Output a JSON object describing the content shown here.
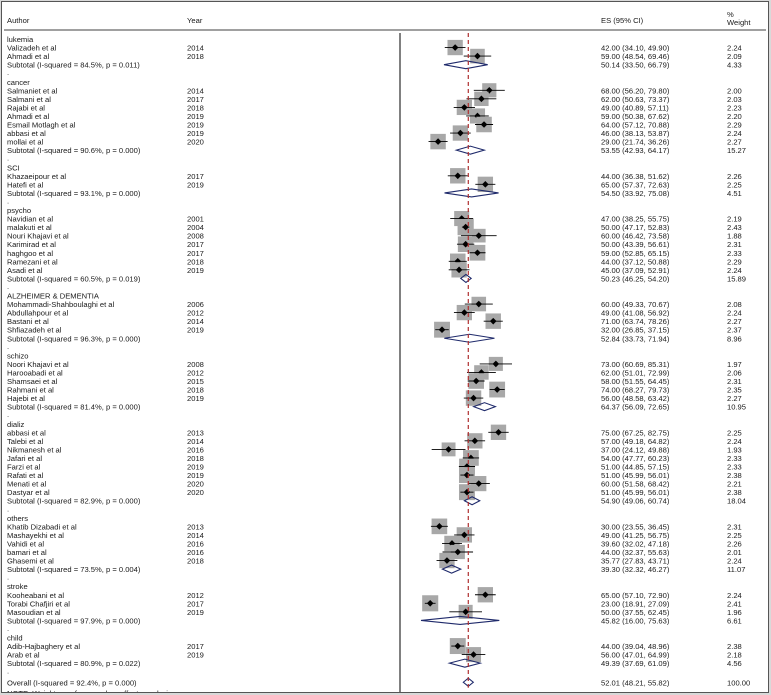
{
  "header": {
    "author": "Author",
    "year": "Year",
    "es": "ES (95% CI)",
    "weight_line1": "%",
    "weight_line2": "Weight"
  },
  "chart_data": {
    "type": "forest",
    "x_axis": {
      "ticks": [
        "-85.3",
        "0",
        "85.3"
      ],
      "tick_values": [
        -85.3,
        0,
        85.3
      ],
      "range": [
        -85.3,
        85.3
      ]
    },
    "overall_line": 52.01,
    "note": "NOTE: Weights are from random effects analysis",
    "groups": [
      {
        "name": "lukemia",
        "studies": [
          {
            "author": "Valizadeh et al",
            "year": "2014",
            "es": 42.0,
            "lo": 34.1,
            "hi": 49.9,
            "ci": "42.00 (34.10, 49.90)",
            "weight": "2.24"
          },
          {
            "author": "Ahmadi et al",
            "year": "2018",
            "es": 59.0,
            "lo": 48.54,
            "hi": 69.46,
            "ci": "59.00 (48.54, 69.46)",
            "weight": "2.09"
          }
        ],
        "subtotal": {
          "label": "Subtotal  (I-squared = 84.5%, p = 0.011)",
          "es": 50.14,
          "lo": 33.5,
          "hi": 66.79,
          "ci": "50.14 (33.50, 66.79)",
          "weight": "4.33"
        }
      },
      {
        "name": "cancer",
        "studies": [
          {
            "author": "Salmaniet et al",
            "year": "2014",
            "es": 68.0,
            "lo": 56.2,
            "hi": 79.8,
            "ci": "68.00 (56.20, 79.80)",
            "weight": "2.00"
          },
          {
            "author": "Salmani et al",
            "year": "2017",
            "es": 62.0,
            "lo": 50.63,
            "hi": 73.37,
            "ci": "62.00 (50.63, 73.37)",
            "weight": "2.03"
          },
          {
            "author": "Rajabi et al",
            "year": "2018",
            "es": 49.0,
            "lo": 40.89,
            "hi": 57.11,
            "ci": "49.00 (40.89, 57.11)",
            "weight": "2.23"
          },
          {
            "author": "Ahmadi et al",
            "year": "2019",
            "es": 59.0,
            "lo": 50.38,
            "hi": 67.62,
            "ci": "59.00 (50.38, 67.62)",
            "weight": "2.20"
          },
          {
            "author": "Esmail Motlagh et al",
            "year": "2019",
            "es": 64.0,
            "lo": 57.12,
            "hi": 70.88,
            "ci": "64.00 (57.12, 70.88)",
            "weight": "2.29"
          },
          {
            "author": "abbasi et al",
            "year": "2019",
            "es": 46.0,
            "lo": 38.13,
            "hi": 53.87,
            "ci": "46.00 (38.13, 53.87)",
            "weight": "2.24"
          },
          {
            "author": "mollai et al",
            "year": "2020",
            "es": 29.0,
            "lo": 21.74,
            "hi": 36.26,
            "ci": "29.00 (21.74, 36.26)",
            "weight": "2.27"
          }
        ],
        "subtotal": {
          "label": "Subtotal  (I-squared = 90.6%, p = 0.000)",
          "es": 53.55,
          "lo": 42.93,
          "hi": 64.17,
          "ci": "53.55 (42.93, 64.17)",
          "weight": "15.27"
        }
      },
      {
        "name": "SCI",
        "studies": [
          {
            "author": "Khazaeipour et al",
            "year": "2017",
            "es": 44.0,
            "lo": 36.38,
            "hi": 51.62,
            "ci": "44.00 (36.38, 51.62)",
            "weight": "2.26"
          },
          {
            "author": "Hatefi et al",
            "year": "2019",
            "es": 65.0,
            "lo": 57.37,
            "hi": 72.63,
            "ci": "65.00 (57.37, 72.63)",
            "weight": "2.25"
          }
        ],
        "subtotal": {
          "label": "Subtotal  (I-squared = 93.1%, p = 0.000)",
          "es": 54.5,
          "lo": 33.92,
          "hi": 75.08,
          "ci": "54.50 (33.92, 75.08)",
          "weight": "4.51"
        }
      },
      {
        "name": "psycho",
        "studies": [
          {
            "author": "Navidian et al",
            "year": "2001",
            "es": 47.0,
            "lo": 38.25,
            "hi": 55.75,
            "ci": "47.00 (38.25, 55.75)",
            "weight": "2.19"
          },
          {
            "author": "malakuti et al",
            "year": "2004",
            "es": 50.0,
            "lo": 47.17,
            "hi": 52.83,
            "ci": "50.00 (47.17, 52.83)",
            "weight": "2.43"
          },
          {
            "author": "Nouri Khajavi et al",
            "year": "2008",
            "es": 60.0,
            "lo": 46.42,
            "hi": 73.58,
            "ci": "60.00 (46.42, 73.58)",
            "weight": "1.88"
          },
          {
            "author": "Karimirad et al",
            "year": "2017",
            "es": 50.0,
            "lo": 43.39,
            "hi": 56.61,
            "ci": "50.00 (43.39, 56.61)",
            "weight": "2.31"
          },
          {
            "author": "haghgoo et al",
            "year": "2017",
            "es": 59.0,
            "lo": 52.85,
            "hi": 65.15,
            "ci": "59.00 (52.85, 65.15)",
            "weight": "2.33"
          },
          {
            "author": "Ramezani et al",
            "year": "2018",
            "es": 44.0,
            "lo": 37.12,
            "hi": 50.88,
            "ci": "44.00 (37.12, 50.88)",
            "weight": "2.29"
          },
          {
            "author": "Asadi et al",
            "year": "2019",
            "es": 45.0,
            "lo": 37.09,
            "hi": 52.91,
            "ci": "45.00 (37.09, 52.91)",
            "weight": "2.24"
          }
        ],
        "subtotal": {
          "label": "Subtotal  (I-squared = 60.5%, p = 0.019)",
          "es": 50.23,
          "lo": 46.25,
          "hi": 54.2,
          "ci": "50.23 (46.25, 54.20)",
          "weight": "15.89"
        }
      },
      {
        "name": "ALZHEIMER & DEMENTIA",
        "studies": [
          {
            "author": "Mohammadi-Shahboulaghi et al",
            "year": "2006",
            "es": 60.0,
            "lo": 49.33,
            "hi": 70.67,
            "ci": "60.00 (49.33, 70.67)",
            "weight": "2.08"
          },
          {
            "author": "Abdullahpour et al",
            "year": "2012",
            "es": 49.0,
            "lo": 41.08,
            "hi": 56.92,
            "ci": "49.00 (41.08, 56.92)",
            "weight": "2.24"
          },
          {
            "author": "Bastani et al",
            "year": "2014",
            "es": 71.0,
            "lo": 63.74,
            "hi": 78.26,
            "ci": "71.00 (63.74, 78.26)",
            "weight": "2.27"
          },
          {
            "author": "Shfiazadeh et al",
            "year": "2019",
            "es": 32.0,
            "lo": 26.85,
            "hi": 37.15,
            "ci": "32.00 (26.85, 37.15)",
            "weight": "2.37"
          }
        ],
        "subtotal": {
          "label": "Subtotal  (I-squared = 96.3%, p = 0.000)",
          "es": 52.84,
          "lo": 33.73,
          "hi": 71.94,
          "ci": "52.84 (33.73, 71.94)",
          "weight": "8.96"
        }
      },
      {
        "name": "schizo",
        "studies": [
          {
            "author": "Noori Khajavi et al",
            "year": "2008",
            "es": 73.0,
            "lo": 60.69,
            "hi": 85.31,
            "ci": "73.00 (60.69, 85.31)",
            "weight": "1.97"
          },
          {
            "author": "Harooabadi et al",
            "year": "2012",
            "es": 62.0,
            "lo": 51.01,
            "hi": 72.99,
            "ci": "62.00 (51.01, 72.99)",
            "weight": "2.06"
          },
          {
            "author": "Shamsaei et al",
            "year": "2015",
            "es": 58.0,
            "lo": 51.55,
            "hi": 64.45,
            "ci": "58.00 (51.55, 64.45)",
            "weight": "2.31"
          },
          {
            "author": "Rahmani et al",
            "year": "2018",
            "es": 74.0,
            "lo": 68.27,
            "hi": 79.73,
            "ci": "74.00 (68.27, 79.73)",
            "weight": "2.35"
          },
          {
            "author": "Hajebi et al",
            "year": "2019",
            "es": 56.0,
            "lo": 48.58,
            "hi": 63.42,
            "ci": "56.00 (48.58, 63.42)",
            "weight": "2.27"
          }
        ],
        "subtotal": {
          "label": "Subtotal  (I-squared = 81.4%, p = 0.000)",
          "es": 64.37,
          "lo": 56.09,
          "hi": 72.65,
          "ci": "64.37 (56.09, 72.65)",
          "weight": "10.95"
        }
      },
      {
        "name": "dializ",
        "studies": [
          {
            "author": "abbasi et al",
            "year": "2013",
            "es": 75.0,
            "lo": 67.25,
            "hi": 82.75,
            "ci": "75.00 (67.25, 82.75)",
            "weight": "2.25"
          },
          {
            "author": "Talebi et al",
            "year": "2014",
            "es": 57.0,
            "lo": 49.18,
            "hi": 64.82,
            "ci": "57.00 (49.18, 64.82)",
            "weight": "2.24"
          },
          {
            "author": "Nikmanesh et al",
            "year": "2016",
            "es": 37.0,
            "lo": 24.12,
            "hi": 49.88,
            "ci": "37.00 (24.12, 49.88)",
            "weight": "1.93"
          },
          {
            "author": "Jafari et al",
            "year": "2018",
            "es": 54.0,
            "lo": 47.77,
            "hi": 60.23,
            "ci": "54.00 (47.77, 60.23)",
            "weight": "2.33"
          },
          {
            "author": "Farzi et al",
            "year": "2019",
            "es": 51.0,
            "lo": 44.85,
            "hi": 57.15,
            "ci": "51.00 (44.85, 57.15)",
            "weight": "2.33"
          },
          {
            "author": "Rafati et al",
            "year": "2019",
            "es": 51.0,
            "lo": 45.99,
            "hi": 56.01,
            "ci": "51.00 (45.99, 56.01)",
            "weight": "2.38"
          },
          {
            "author": "Menati et al",
            "year": "2020",
            "es": 60.0,
            "lo": 51.58,
            "hi": 68.42,
            "ci": "60.00 (51.58, 68.42)",
            "weight": "2.21"
          },
          {
            "author": "Dastyar et al",
            "year": "2020",
            "es": 51.0,
            "lo": 45.99,
            "hi": 56.01,
            "ci": "51.00 (45.99, 56.01)",
            "weight": "2.38"
          }
        ],
        "subtotal": {
          "label": "Subtotal  (I-squared = 82.9%, p = 0.000)",
          "es": 54.9,
          "lo": 49.06,
          "hi": 60.74,
          "ci": "54.90 (49.06, 60.74)",
          "weight": "18.04"
        }
      },
      {
        "name": "others",
        "studies": [
          {
            "author": "Khatib Dizabadi et al",
            "year": "2013",
            "es": 30.0,
            "lo": 23.55,
            "hi": 36.45,
            "ci": "30.00 (23.55, 36.45)",
            "weight": "2.31"
          },
          {
            "author": "Mashayekhi et al",
            "year": "2014",
            "es": 49.0,
            "lo": 41.25,
            "hi": 56.75,
            "ci": "49.00 (41.25, 56.75)",
            "weight": "2.25"
          },
          {
            "author": "Vahidi et al",
            "year": "2016",
            "es": 39.6,
            "lo": 32.02,
            "hi": 47.18,
            "ci": "39.60 (32.02, 47.18)",
            "weight": "2.26"
          },
          {
            "author": "bamari et al",
            "year": "2016",
            "es": 44.0,
            "lo": 32.37,
            "hi": 55.63,
            "ci": "44.00 (32.37, 55.63)",
            "weight": "2.01"
          },
          {
            "author": "Ghasemi et al",
            "year": "2018",
            "es": 35.77,
            "lo": 27.83,
            "hi": 43.71,
            "ci": "35.77 (27.83, 43.71)",
            "weight": "2.24"
          }
        ],
        "subtotal": {
          "label": "Subtotal  (I-squared = 73.5%, p = 0.004)",
          "es": 39.3,
          "lo": 32.32,
          "hi": 46.27,
          "ci": "39.30 (32.32, 46.27)",
          "weight": "11.07"
        }
      },
      {
        "name": "stroke",
        "studies": [
          {
            "author": "Kooheabani et al",
            "year": "2012",
            "es": 65.0,
            "lo": 57.1,
            "hi": 72.9,
            "ci": "65.00 (57.10, 72.90)",
            "weight": "2.24"
          },
          {
            "author": "Torabi Chafjiri et al",
            "year": "2017",
            "es": 23.0,
            "lo": 18.91,
            "hi": 27.09,
            "ci": "23.00 (18.91, 27.09)",
            "weight": "2.41"
          },
          {
            "author": "Masoudian et al",
            "year": "2019",
            "es": 50.0,
            "lo": 37.55,
            "hi": 62.45,
            "ci": "50.00 (37.55, 62.45)",
            "weight": "1.96"
          }
        ],
        "subtotal": {
          "label": "Subtotal  (I-squared = 97.9%, p = 0.000)",
          "es": 45.82,
          "lo": 16.0,
          "hi": 75.63,
          "ci": "45.82 (16.00, 75.63)",
          "weight": "6.61"
        }
      },
      {
        "name": "child",
        "studies": [
          {
            "author": "Adib-Hajbaghery et al",
            "year": "2017",
            "es": 44.0,
            "lo": 39.04,
            "hi": 48.96,
            "ci": "44.00 (39.04, 48.96)",
            "weight": "2.38"
          },
          {
            "author": "Arab et al",
            "year": "2019",
            "es": 56.0,
            "lo": 47.01,
            "hi": 64.99,
            "ci": "56.00 (47.01, 64.99)",
            "weight": "2.18"
          }
        ],
        "subtotal": {
          "label": "Subtotal  (I-squared = 80.9%, p = 0.022)",
          "es": 49.39,
          "lo": 37.69,
          "hi": 61.09,
          "ci": "49.39 (37.69, 61.09)",
          "weight": "4.56"
        }
      }
    ],
    "overall": {
      "label": "Overall  (I-squared = 92.4%, p = 0.000)",
      "es": 52.01,
      "lo": 48.21,
      "hi": 55.82,
      "ci": "52.01 (48.21, 55.82)",
      "weight": "100.00"
    },
    "colors": {
      "diamond": "#1f2a6b",
      "box": "#a8a8a8",
      "dashed": "#b03030",
      "line": "#000000"
    }
  }
}
